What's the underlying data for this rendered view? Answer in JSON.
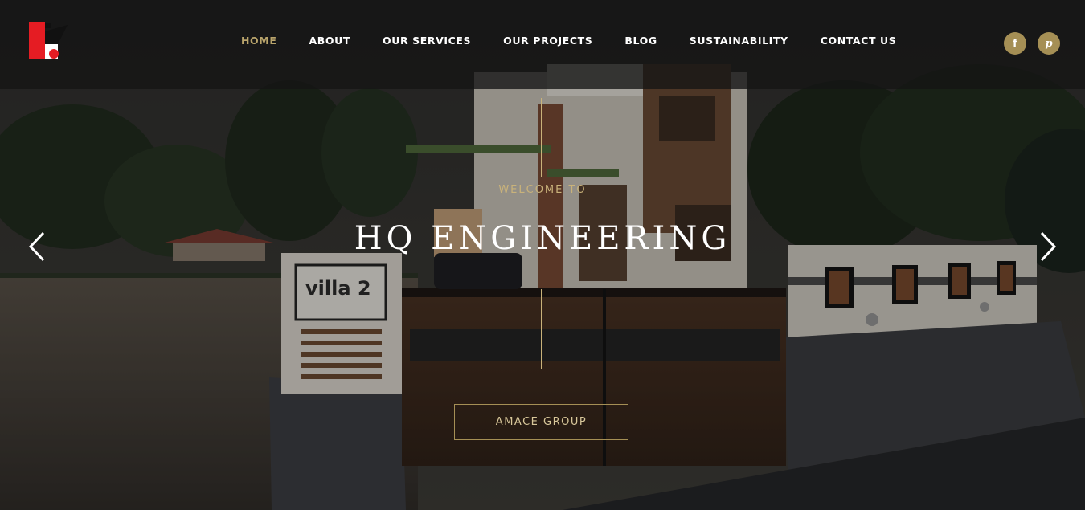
{
  "nav": {
    "items": [
      {
        "label": "HOME",
        "active": true
      },
      {
        "label": "ABOUT",
        "active": false
      },
      {
        "label": "OUR SERVICES",
        "active": false
      },
      {
        "label": "OUR PROJECTS",
        "active": false
      },
      {
        "label": "BLOG",
        "active": false
      },
      {
        "label": "SUSTAINABILITY",
        "active": false
      },
      {
        "label": "CONTACT US",
        "active": false
      }
    ]
  },
  "social": {
    "facebook_glyph": "f",
    "pinterest_glyph": "p"
  },
  "hero": {
    "welcome": "WELCOME TO",
    "title": "HQ ENGINEERING",
    "cta_label": "AMACE GROUP",
    "sign_text": "villa 2"
  },
  "colors": {
    "accent": "#b9a46b",
    "cta_border": "#a58f55",
    "header_bg": "#141414",
    "logo_red": "#e51c23"
  },
  "icons": {
    "logo": "company-logo",
    "facebook": "facebook-icon",
    "pinterest": "pinterest-icon",
    "prev": "chevron-left-icon",
    "next": "chevron-right-icon"
  }
}
